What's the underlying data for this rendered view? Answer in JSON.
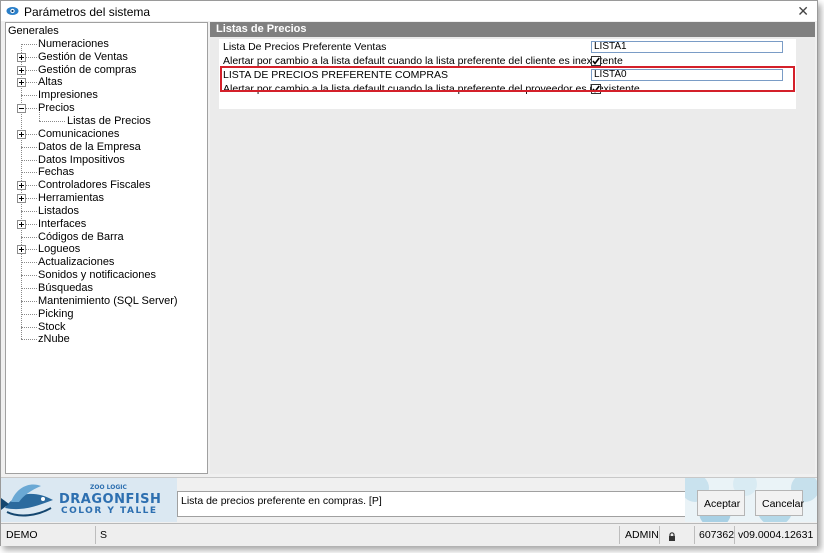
{
  "window": {
    "title": "Parámetros del sistema"
  },
  "tree": {
    "items": [
      {
        "label": "Generales",
        "expander": "none"
      },
      {
        "label": "Numeraciones",
        "expander": "none"
      },
      {
        "label": "Gestión de Ventas",
        "expander": "plus"
      },
      {
        "label": "Gestión de compras",
        "expander": "plus"
      },
      {
        "label": "Altas",
        "expander": "plus"
      },
      {
        "label": "Impresiones",
        "expander": "none"
      },
      {
        "label": "Precios",
        "expander": "minus"
      },
      {
        "label": "Listas de Precios",
        "expander": "none",
        "child": true
      },
      {
        "label": "Comunicaciones",
        "expander": "plus"
      },
      {
        "label": "Datos de la Empresa",
        "expander": "none"
      },
      {
        "label": "Datos Impositivos",
        "expander": "none"
      },
      {
        "label": "Fechas",
        "expander": "none"
      },
      {
        "label": "Controladores Fiscales",
        "expander": "plus"
      },
      {
        "label": "Herramientas",
        "expander": "plus"
      },
      {
        "label": "Listados",
        "expander": "none"
      },
      {
        "label": "Interfaces",
        "expander": "plus"
      },
      {
        "label": "Códigos de Barra",
        "expander": "none"
      },
      {
        "label": "Logueos",
        "expander": "plus"
      },
      {
        "label": "Actualizaciones",
        "expander": "none"
      },
      {
        "label": "Sonidos y notificaciones",
        "expander": "none"
      },
      {
        "label": "Búsquedas",
        "expander": "none"
      },
      {
        "label": "Mantenimiento (SQL Server)",
        "expander": "none"
      },
      {
        "label": "Picking",
        "expander": "none"
      },
      {
        "label": "Stock",
        "expander": "none"
      },
      {
        "label": "zNube",
        "expander": "none"
      }
    ]
  },
  "section": {
    "title": "Listas de Precios"
  },
  "properties": [
    {
      "label": "Lista De Precios Preferente Ventas",
      "type": "text",
      "value": "LISTA1"
    },
    {
      "label": "Alertar por cambio a la lista default cuando la lista preferente del cliente es inexistente",
      "type": "checkbox",
      "checked": true
    },
    {
      "label": "LISTA DE PRECIOS PREFERENTE COMPRAS",
      "type": "text",
      "value": "LISTA0"
    },
    {
      "label": "Alertar por cambio a la lista default cuando la lista preferente del proveedor es inexistente",
      "type": "checkbox",
      "checked": true
    }
  ],
  "logo": {
    "brand": "DRAGONFISH",
    "sub": "COLOR Y TALLE",
    "company": "ZOO LOGIC"
  },
  "footer": {
    "message": "Lista de precios preferente en compras. [P]",
    "accept_label": "Aceptar",
    "cancel_label": "Cancelar"
  },
  "status": {
    "env": "DEMO",
    "mode": "S",
    "user": "ADMIN",
    "lock_icon": "lock-icon",
    "code": "607362",
    "version": "v09.0004.12631"
  },
  "colors": {
    "section_header": "#808080",
    "highlight": "#d4202a",
    "brand": "#2d6fb0"
  }
}
